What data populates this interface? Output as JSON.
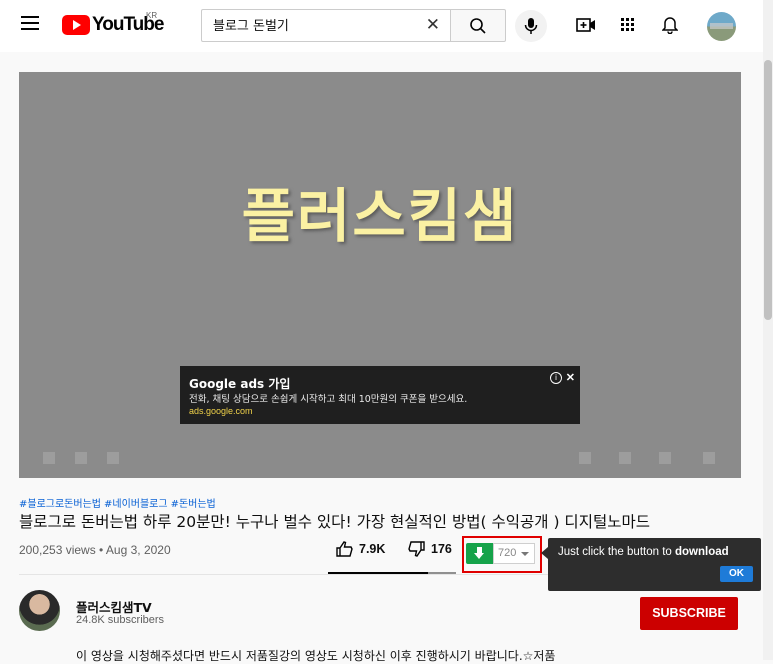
{
  "header": {
    "logo_text": "YouTube",
    "region": "KR",
    "search": {
      "value": "블로그 돈벌기"
    }
  },
  "player": {
    "title_overlay": "플러스킴샘",
    "ad": {
      "title": "Google ads 가입",
      "description": "전화, 채팅 상담으로 손쉽게 시작하고 최대 10만원의 쿠폰을 받으세요.",
      "url": "ads.google.com"
    }
  },
  "video": {
    "hashtags": [
      "#블로그로돈버는법",
      "#네이버블로그",
      "#돈버는법"
    ],
    "title": "블로그로 돈버는법 하루 20분만! 누구나 벌수 있다! 가장 현실적인 방법( 수익공개 ) 디지털노마드",
    "views_date": "200,253 views • Aug 3, 2020",
    "likes": "7.9K",
    "dislikes": "176"
  },
  "download": {
    "quality": "720",
    "tooltip_prefix": "Just click the button to ",
    "tooltip_bold": "download",
    "ok_label": "OK"
  },
  "channel": {
    "name": "플러스킴샘TV",
    "subscribers": "24.8K subscribers",
    "subscribe_label": "SUBSCRIBE"
  },
  "description": "이 영상을 시청해주셨다면 반드시 저품질강의 영상도 시청하신 이후 진행하시기 바랍니다.☆저품",
  "colors": {
    "accent_red": "#cc0000",
    "link_blue": "#065fd4",
    "download_green": "#16a34a"
  }
}
